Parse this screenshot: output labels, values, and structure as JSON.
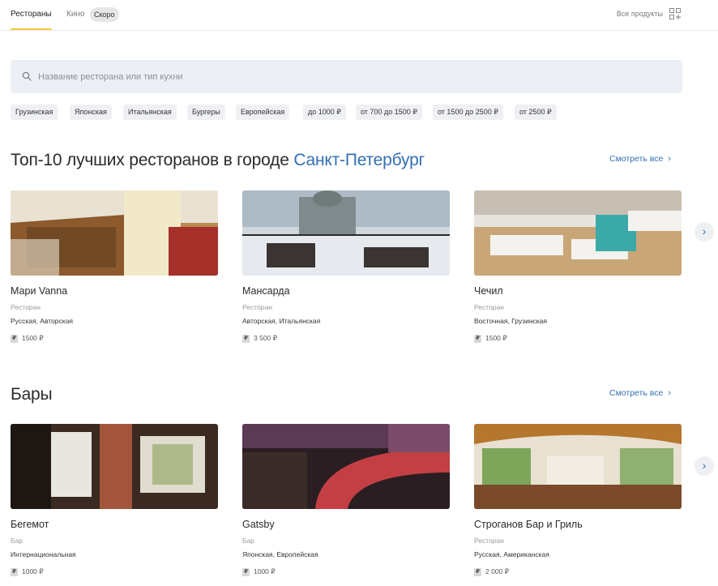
{
  "nav": {
    "tabs": [
      {
        "label": "Рестораны"
      },
      {
        "label": "Кино"
      }
    ],
    "soon_badge": "Скоро",
    "all_products": "Все продукты"
  },
  "search": {
    "placeholder": "Название ресторана или тип кухни",
    "value": ""
  },
  "filters": [
    "Грузинская",
    "Японская",
    "Итальянская",
    "Бургеры",
    "Европейская",
    "до 1000 ₽",
    "от 700 до 1500 ₽",
    "от 1500 до 2500 ₽",
    "от 2500 ₽"
  ],
  "sections": [
    {
      "title_prefix": "Топ-10 лучших ресторанов в городе ",
      "city": "Санкт-Петербург",
      "see_all": "Смотреть все",
      "cards": [
        {
          "name": "Мари Vanna",
          "type": "Ресторан",
          "cuisine": "Русская, Авторская",
          "price": "1500 ₽",
          "price_badge": "₽"
        },
        {
          "name": "Мансарда",
          "type": "Ресторан",
          "cuisine": "Авторская, Итальянская",
          "price": "3 500 ₽",
          "price_badge": "₽"
        },
        {
          "name": "Чечил",
          "type": "Ресторан",
          "cuisine": "Восточная, Грузинская",
          "price": "1500 ₽",
          "price_badge": "₽"
        }
      ]
    },
    {
      "title": "Бары",
      "see_all": "Смотреть все",
      "cards": [
        {
          "name": "Бегемот",
          "type": "Бар",
          "cuisine": "Интернациональная",
          "price": "1000 ₽",
          "price_badge": "₽"
        },
        {
          "name": "Gatsby",
          "type": "Бар",
          "cuisine": "Японская, Европейская",
          "price": "1000 ₽",
          "price_badge": "₽"
        },
        {
          "name": "Строганов Бар и Гриль",
          "type": "Ресторан",
          "cuisine": "Русская, Американская",
          "price": "2 000 ₽",
          "price_badge": "₽"
        }
      ]
    }
  ],
  "colors": {
    "accent": "#336fb1",
    "tab_underline": "#f6c636",
    "search_bg": "#eceff4"
  },
  "icons": {
    "search": "search-icon",
    "grid": "grid-plus-icon",
    "next": "chevron-right-icon"
  }
}
